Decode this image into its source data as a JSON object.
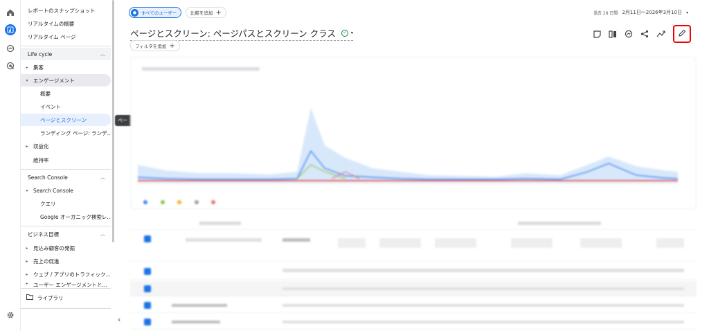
{
  "rail": {
    "icons": [
      "home-icon",
      "reports-icon",
      "explore-icon",
      "advertising-icon"
    ],
    "settings": "settings-icon"
  },
  "nav": {
    "items_top": [
      {
        "label": "レポートのスナップショット"
      },
      {
        "label": "リアルタイムの概要"
      },
      {
        "label": "リアルタイム ページ"
      }
    ],
    "lifecycle": {
      "header": "Life cycle",
      "items": [
        {
          "label": "集客",
          "arrow": "▸"
        },
        {
          "label": "エンゲージメント",
          "arrow": "▾"
        },
        {
          "label": "概要"
        },
        {
          "label": "イベント"
        },
        {
          "label": "ページとスクリーン"
        },
        {
          "label": "ランディング ページ: ランデ..."
        },
        {
          "label": "収益化",
          "arrow": "▸"
        },
        {
          "label": "維持率"
        }
      ]
    },
    "search_console": {
      "header": "Search Console",
      "items": [
        {
          "label": "Search Console",
          "arrow": "▾"
        },
        {
          "label": "クエリ"
        },
        {
          "label": "Google オーガニック検索レ..."
        }
      ]
    },
    "business": {
      "header": "ビジネス目標",
      "items": [
        {
          "label": "見込み顧客の発掘",
          "arrow": "▸"
        },
        {
          "label": "売上の促進",
          "arrow": "▸"
        },
        {
          "label": "ウェブ / アプリのトラフィック...",
          "arrow": "▸"
        },
        {
          "label": "ユーザー エンゲージメントと...",
          "arrow": "▸"
        }
      ]
    },
    "library": "ライブラリ",
    "collapse": "‹",
    "tooltip": "ペー"
  },
  "header": {
    "segment_chip": "すべてのユーザー",
    "segment_letter": "すべ",
    "compare_chip": "比較を追加",
    "date_prefix": "過去 28 日間",
    "date_range": "2月11日～2026年3月10日",
    "title": "ページとスクリーン: ページパスとスクリーン クラス",
    "filter_chip": "フィルタを追加"
  },
  "toolbar": [
    "customize-report-icon",
    "compare-icon",
    "insights-icon",
    "share-icon",
    "trend-icon",
    "edit-icon"
  ],
  "colors": {
    "accent": "#1a73e8",
    "highlight": "#ee0000",
    "series": [
      "#4285f4",
      "#a8c8f0",
      "#8bc34a",
      "#f6ae2d",
      "#e57373"
    ]
  }
}
